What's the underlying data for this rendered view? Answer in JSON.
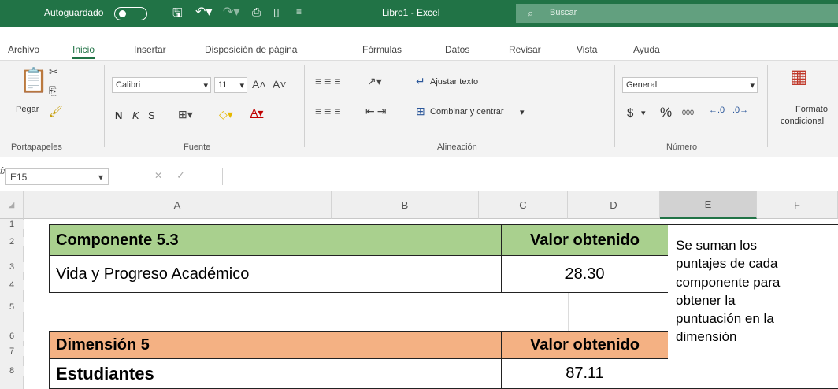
{
  "titlebar": {
    "autosave": "Autoguardado",
    "doc_title": "Libro1 - Excel",
    "search": "Buscar"
  },
  "menu": [
    "Archivo",
    "Inicio",
    "Insertar",
    "Disposición de página",
    "Fórmulas",
    "Datos",
    "Revisar",
    "Vista",
    "Ayuda"
  ],
  "ribbon": {
    "paste": "Pegar",
    "font_name": "Calibri",
    "font_size": "11",
    "bold": "N",
    "italic": "K",
    "underline": "S",
    "wrap_text": "Ajustar texto",
    "merge_center": "Combinar y centrar",
    "number_format": "General",
    "percent": "%",
    "thousands": "000",
    "currency": "$",
    "cond_format_1": "Formato",
    "cond_format_2": "condicional",
    "groups": {
      "clipboard": "Portapapeles",
      "font": "Fuente",
      "alignment": "Alineación",
      "number": "Número"
    }
  },
  "formula_bar": {
    "name_box": "E15",
    "fx": "fx"
  },
  "columns": [
    "A",
    "B",
    "C",
    "D",
    "E",
    "F"
  ],
  "rows": [
    "1",
    "2",
    "3",
    "4",
    "5",
    "6",
    "7",
    "8"
  ],
  "table1": {
    "header": "Componente 5.3",
    "value_header": "Valor obtenido",
    "label": "Vida y Progreso Académico",
    "value": "28.30"
  },
  "table2": {
    "header": "Dimensión 5",
    "value_header": "Valor obtenido",
    "label": "Estudiantes",
    "value": "87.11"
  },
  "note": [
    "Se suman los",
    "puntajes de cada",
    "componente para",
    "obtener la",
    "puntuación en la",
    "dimensión"
  ],
  "colors": {
    "excel_green": "#217346",
    "header_green": "#a9d08e",
    "header_orange": "#f4b183"
  }
}
